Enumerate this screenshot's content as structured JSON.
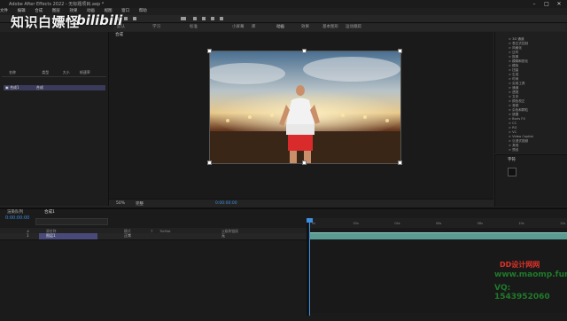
{
  "window": {
    "title": "Adobe After Effects 2022 - 无标题项目.aep *",
    "controls": {
      "minimize": "–",
      "maximize": "□",
      "close": "✕"
    }
  },
  "watermark": {
    "text": "知识白嫖怪",
    "logo_text": "bilibili",
    "brand": "DD设计网网",
    "url": "www.maomp.fun",
    "qq": "VQ: 1543952060"
  },
  "menu": [
    "文件",
    "编辑",
    "合成",
    "图层",
    "效果",
    "动画",
    "视图",
    "窗口",
    "帮助"
  ],
  "workspace_tabs": [
    "默认",
    "学习",
    "标准",
    "小屏幕",
    "库",
    "动画",
    "效果",
    "基本图形",
    "运动跟踪"
  ],
  "project": {
    "columns": [
      "名称",
      "类型",
      "大小",
      "帧速率"
    ],
    "rows": [
      {
        "name": "合成1",
        "type": "合成"
      }
    ]
  },
  "viewer": {
    "tab_label": "合成",
    "zoom": "50%",
    "resolution": "完整",
    "timecode": "0:00:00:00"
  },
  "effects": {
    "items": [
      "> 3D 通道",
      "> 表达式控制",
      "> 风格化",
      "> 过时",
      "> 抠像",
      "> 模糊和锐化",
      "> 模拟",
      "> 扭曲",
      "> 生成",
      "> 时间",
      "> 实用工具",
      "> 通道",
      "> 透视",
      "> 文本",
      "> 颜色校正",
      "> 音频",
      "> 杂色和颗粒",
      "> 遮罩",
      "> Boris FX",
      "> CC",
      "> RG",
      "> VC",
      "> Video Copilot",
      "> 沉浸式视频",
      "> 其他",
      "> 预设"
    ]
  },
  "character": {
    "title": "字符"
  },
  "timeline": {
    "tabs": [
      "渲染队列",
      "合成1"
    ],
    "timecode": "0:00:00:00",
    "search_placeholder": "",
    "layer_header": [
      "#",
      "源名称",
      "模式",
      "T",
      "TrkMat",
      "父级和链接"
    ],
    "layer": {
      "index": "1",
      "name": "图层1",
      "mode": "正常",
      "parent": "无"
    },
    "ruler_ticks": [
      "0s",
      "02s",
      "04s",
      "06s",
      "08s",
      "10s",
      "12s"
    ]
  },
  "colors": {
    "accent_blue": "#3c8fe0",
    "track_green": "#5a9b94",
    "selection": "#4a4a7a"
  }
}
